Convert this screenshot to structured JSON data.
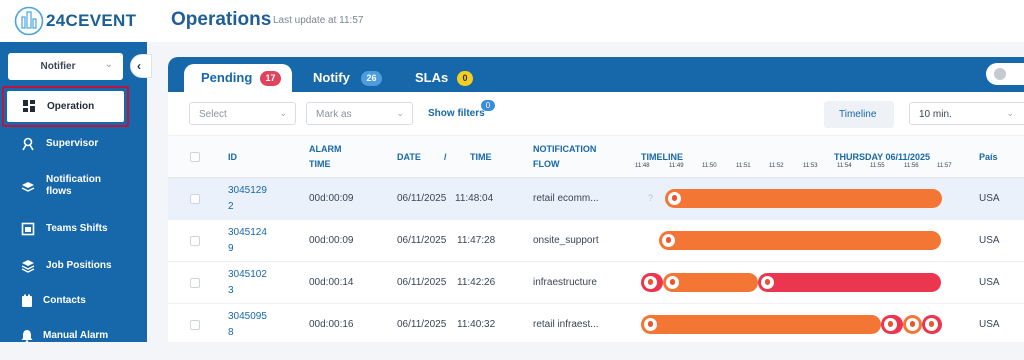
{
  "app": {
    "logo_text": "24CEVENT",
    "page_title": "Operations",
    "last_update": "Last update at 11:57"
  },
  "sidebar": {
    "selector_value": "Notifier",
    "items": [
      {
        "label": "Operation",
        "icon": "dashboard-icon",
        "active": true
      },
      {
        "label": "Supervisor",
        "icon": "supervisor-icon"
      },
      {
        "label": "Notification flows",
        "label_line1": "Notification",
        "label_line2": "flows",
        "icon": "layers-icon"
      },
      {
        "label": "Teams Shifts",
        "icon": "calendar-icon"
      },
      {
        "label": "Job Positions",
        "icon": "stack-icon"
      },
      {
        "label": "Contacts",
        "icon": "contacts-icon"
      },
      {
        "label": "Manual Alarm",
        "icon": "bell-icon"
      }
    ]
  },
  "tabs": [
    {
      "label": "Pending",
      "badge": "17",
      "badge_color": "#e0435b",
      "active": true
    },
    {
      "label": "Notify",
      "badge": "26",
      "badge_color": "#4b9ddf"
    },
    {
      "label": "SLAs",
      "badge": "0",
      "badge_color": "#f4cf1f"
    }
  ],
  "filters": {
    "select_placeholder": "Select",
    "mark_as_placeholder": "Mark as",
    "show_filters_label": "Show filters",
    "show_filters_count": "0",
    "timeline_button": "Timeline",
    "interval_value": "10 min."
  },
  "table": {
    "headers": {
      "id": "ID",
      "alarm_time_line1": "ALARM",
      "alarm_time_line2": "TIME",
      "date": "DATE",
      "separator": "/",
      "time": "TIME",
      "flow_line1": "NOTIFICATION",
      "flow_line2": "FLOW",
      "timeline": "TIMELINE",
      "timeline_date": "THURSDAY 06/11/2025",
      "country": "País"
    },
    "timeline_ticks": [
      "11:48",
      "11:49",
      "11:50",
      "11:51",
      "11:52",
      "11:53",
      "11:54",
      "11:55",
      "11:56",
      "11:57"
    ],
    "rows": [
      {
        "id_line1": "3045129",
        "id_line2": "2",
        "alarm_time": "00d:00:09",
        "date": "06/11/2025",
        "time": "11:48:04",
        "flow": "retail ecomm...",
        "country": "USA",
        "selected": true
      },
      {
        "id_line1": "3045124",
        "id_line2": "9",
        "alarm_time": "00d:00:09",
        "date": "06/11/2025",
        "time": "11:47:28",
        "flow": "onsite_support",
        "country": "USA"
      },
      {
        "id_line1": "3045102",
        "id_line2": "3",
        "alarm_time": "00d:00:14",
        "date": "06/11/2025",
        "time": "11:42:26",
        "flow": "infraestructure",
        "country": "USA"
      },
      {
        "id_line1": "3045095",
        "id_line2": "8",
        "alarm_time": "00d:00:16",
        "date": "06/11/2025",
        "time": "11:40:32",
        "flow": "retail infraest...",
        "country": "USA"
      }
    ],
    "colors": {
      "orange": "#f47634",
      "red": "#eb3650"
    }
  }
}
